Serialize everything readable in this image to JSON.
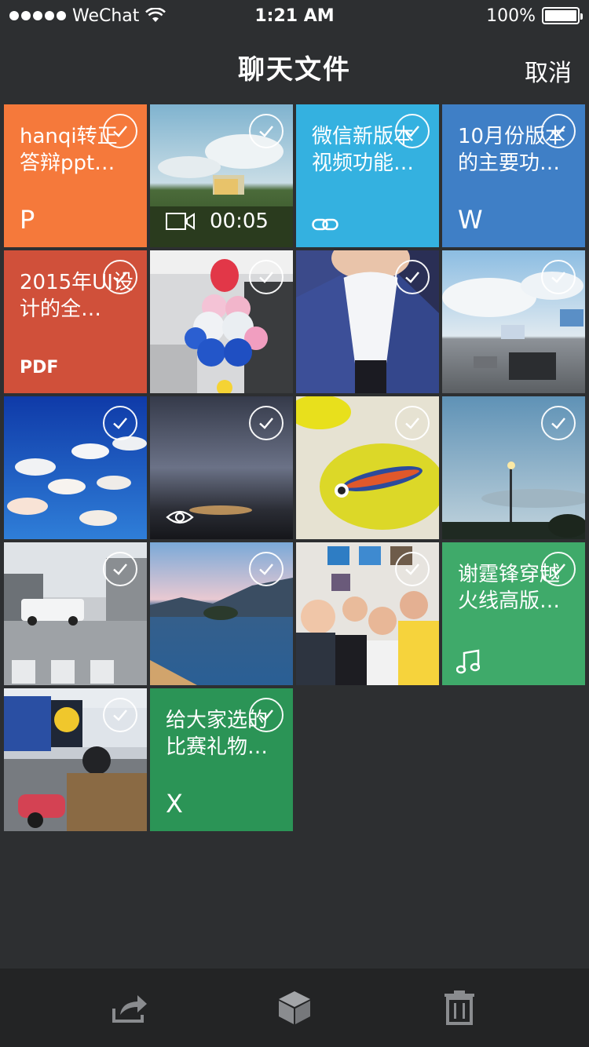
{
  "status_bar": {
    "carrier": "WeChat",
    "time": "1:21 AM",
    "battery": "100%"
  },
  "nav": {
    "title": "聊天文件",
    "cancel_label": "取消"
  },
  "tiles": [
    {
      "kind": "doc",
      "title": "hanqi转正答辩ppt…",
      "type_label": "P",
      "color": "#f5793b",
      "selected": true
    },
    {
      "kind": "video",
      "duration": "00:05",
      "selected": true
    },
    {
      "kind": "link",
      "title": "微信新版本视频功能…",
      "color": "#34b1e0",
      "icon": "link-icon",
      "selected": true
    },
    {
      "kind": "doc",
      "title": "10月份版本的主要功…",
      "type_label": "W",
      "color": "#3f7fc6",
      "selected": true
    },
    {
      "kind": "doc",
      "title": "2015年UI设计的全…",
      "type_label": "PDF",
      "color": "#d0503a",
      "selected": true
    },
    {
      "kind": "photo",
      "subject": "balloons",
      "selected": true
    },
    {
      "kind": "photo",
      "subject": "selfie",
      "selected": true
    },
    {
      "kind": "photo",
      "subject": "road-sky",
      "selected": true
    },
    {
      "kind": "photo",
      "subject": "aquarium-fish",
      "selected": true
    },
    {
      "kind": "photo",
      "subject": "night-sky",
      "icon": "eye-icon",
      "selected": true
    },
    {
      "kind": "photo",
      "subject": "yellow-fish",
      "selected": true
    },
    {
      "kind": "photo",
      "subject": "streetlight-sky",
      "selected": true
    },
    {
      "kind": "photo",
      "subject": "street-truck",
      "selected": true
    },
    {
      "kind": "photo",
      "subject": "lake",
      "selected": true
    },
    {
      "kind": "photo",
      "subject": "group-photo",
      "selected": true
    },
    {
      "kind": "music",
      "title": "谢霆锋穿越火线高版…",
      "color": "#3faa6a",
      "icon": "music-note-icon",
      "selected": true
    },
    {
      "kind": "photo",
      "subject": "motorbike-street",
      "selected": true
    },
    {
      "kind": "doc",
      "title": "给大家选的比赛礼物…",
      "type_label": "X",
      "color": "#2b9456",
      "selected": true
    }
  ],
  "toolbar": {
    "icons": [
      "share-icon",
      "box-icon",
      "trash-icon"
    ]
  }
}
